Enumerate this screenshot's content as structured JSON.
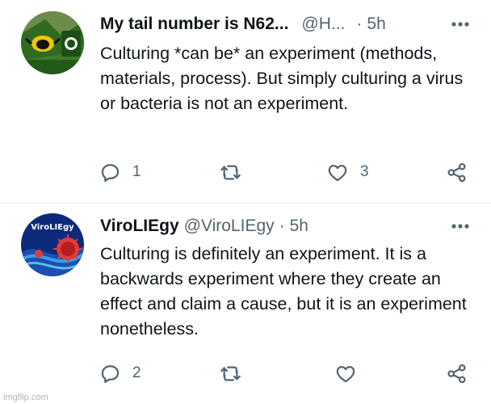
{
  "tweets": [
    {
      "name": "My tail number is N62...",
      "handle": "@H...",
      "separator": "·",
      "time": "5h",
      "text": "Culturing *can be* an experiment (methods, materials, process). But simply culturing a virus or bacteria is not an experiment.",
      "reply_count": "1",
      "retweet_count": "",
      "like_count": "3",
      "avatar": {
        "description": "iowa-hawkeye-and-celtic-logo",
        "colors": [
          "#2f6a20",
          "#f2c500",
          "#111111"
        ]
      }
    },
    {
      "name": "ViroLIEgy",
      "handle": "@ViroLIEgy",
      "separator": "·",
      "time": "5h",
      "text": "Culturing is definitely an experiment. It is a backwards experiment where they create an effect and claim a cause, but it is an experiment nonetheless.",
      "reply_count": "2",
      "retweet_count": "",
      "like_count": "",
      "avatar": {
        "label": "ViroLIEgy",
        "colors": [
          "#0d2a7a",
          "#e23a3a",
          "#37a0e6"
        ]
      }
    }
  ],
  "watermark": "imgflip.com",
  "icons": [
    "more-icon",
    "reply-icon",
    "retweet-icon",
    "like-icon",
    "share-icon"
  ],
  "colors": {
    "text": "#0f1419",
    "secondary": "#536471",
    "divider": "#e6e9ec"
  }
}
